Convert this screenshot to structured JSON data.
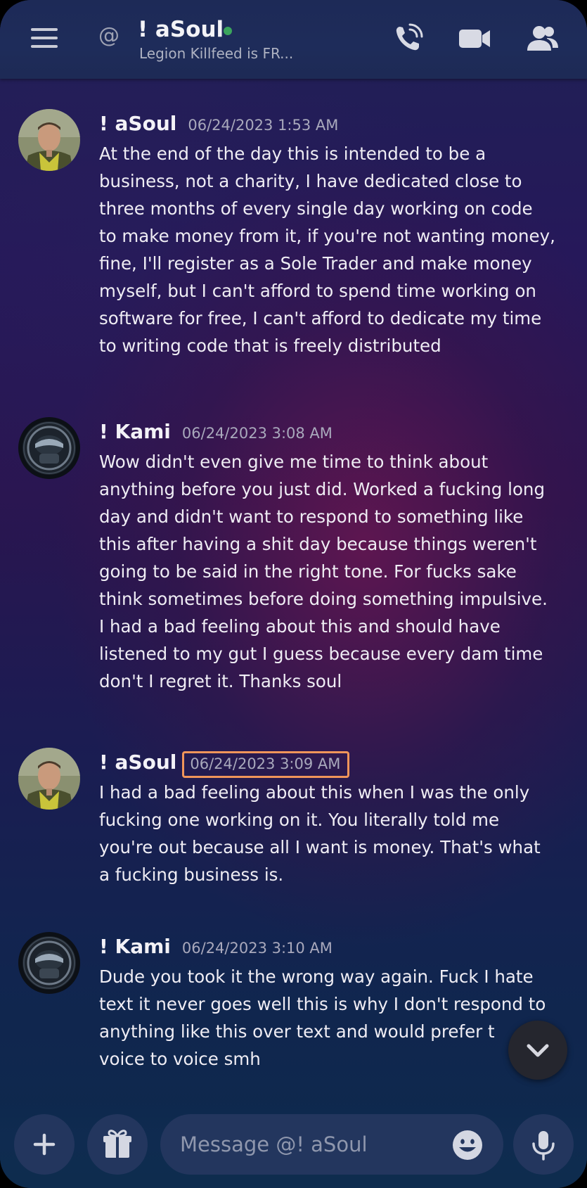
{
  "header": {
    "menu_icon": "hamburger-menu-icon",
    "at_symbol": "@",
    "name": "! aSoul",
    "status_color": "#3ba55d",
    "status_text": "Legion Killfeed is FR...",
    "call_icon": "voice-call-icon",
    "video_icon": "video-call-icon",
    "members_icon": "members-icon"
  },
  "messages": [
    {
      "author": "! aSoul",
      "timestamp": "06/24/2023 1:53 AM",
      "avatar": "soldier-avatar",
      "lines": [
        "At the end of the day this is intended to be a",
        "business, not a charity, I have dedicated close to",
        "three months of every single day working on code",
        "to make money from it, if you're not wanting money,",
        "fine, I'll register as a Sole Trader and make money",
        "myself, but I can't afford to spend time working on",
        "software for free, I can't afford to dedicate my time",
        "to writing code that is freely distributed"
      ]
    },
    {
      "author": "! Kami",
      "timestamp": "06/24/2023 3:08 AM",
      "avatar": "helmet-avatar",
      "lines": [
        "Wow didn't even give me time to think about",
        "anything before you just did. Worked a fucking long",
        "day and didn't want to respond to something like",
        "this after having a shit day because things weren't",
        "going to be said in the right tone. For fucks sake",
        "think sometimes before doing something impulsive.",
        "I had a bad feeling about this and should have",
        "listened to my gut I guess because every dam time",
        "don't I regret it. Thanks soul"
      ]
    },
    {
      "author": "! aSoul",
      "timestamp": "06/24/2023 3:09 AM",
      "timestamp_highlight_color": "#f0955a",
      "avatar": "soldier-avatar",
      "lines": [
        "I had a bad feeling about this when I was the only",
        "fucking one working on it. You literally told me",
        "you're out because all I want is money. That's what",
        "a fucking business is."
      ]
    },
    {
      "author": "! Kami",
      "timestamp": "06/24/2023 3:10 AM",
      "avatar": "helmet-avatar",
      "lines": [
        "Dude you took it the wrong way again. Fuck I hate",
        "text it never goes well this is why I don't respond to",
        "anything like this over text and would prefer t",
        "voice to voice smh"
      ]
    }
  ],
  "scroll_button_icon": "chevron-down-icon",
  "composer": {
    "add_icon": "plus-icon",
    "gift_icon": "gift-icon",
    "placeholder": "Message @! aSoul",
    "emoji_icon": "emoji-icon",
    "mic_icon": "microphone-icon"
  }
}
